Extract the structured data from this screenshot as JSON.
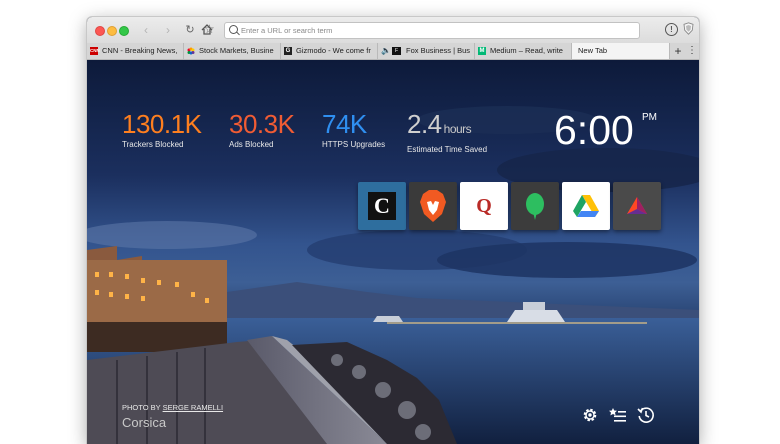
{
  "toolbar": {
    "url_placeholder": "Enter a URL or search term"
  },
  "tabs": [
    {
      "label": "CNN - Breaking News,",
      "favicon": "cnn-favicon"
    },
    {
      "label": "Stock Markets, Busine",
      "favicon": "nbc-peacock-favicon"
    },
    {
      "label": "Gizmodo - We come fr",
      "favicon": "gizmodo-favicon"
    },
    {
      "label": "Fox Business | Bus",
      "favicon": "fox-speaker-favicon"
    },
    {
      "label": "Medium – Read, write",
      "favicon": "medium-favicon"
    },
    {
      "label": "New Tab",
      "favicon": "none"
    }
  ],
  "stats": [
    {
      "value": "130.1K",
      "unit": "",
      "label": "Trackers Blocked",
      "color": "#fe7f1f"
    },
    {
      "value": "30.3K",
      "unit": "",
      "label": "Ads Blocked",
      "color": "#f05c34"
    },
    {
      "value": "74K",
      "unit": "",
      "label": "HTTPS Upgrades",
      "color": "#2f8ff0"
    },
    {
      "value": "2.4",
      "unit": "hours",
      "label": "Estimated Time Saved",
      "color": "#cfcfcf"
    }
  ],
  "clock": {
    "time": "6:00",
    "ampm": "PM"
  },
  "top_sites": [
    {
      "name": "cnet-tile",
      "bg": "#2e6e9e"
    },
    {
      "name": "brave-tile",
      "bg": "#3a3a3a"
    },
    {
      "name": "quora-tile",
      "bg": "#ffffff"
    },
    {
      "name": "evernote-tile",
      "bg": "#3c3c3c"
    },
    {
      "name": "google-drive-tile",
      "bg": "#ffffff"
    },
    {
      "name": "bat-tile",
      "bg": "#4a4a4a"
    }
  ],
  "photo": {
    "credit_prefix": "PHOTO BY",
    "photographer": "SERGE RAMELLI",
    "location": "Corsica"
  }
}
